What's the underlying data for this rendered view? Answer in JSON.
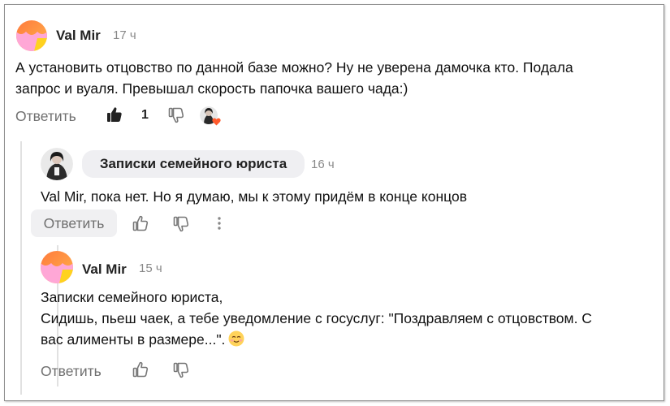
{
  "comments": [
    {
      "author": "Val Mir",
      "time": "17 ч",
      "text_line1": "А установить отцовство по данной базе можно? Ну не уверена дамочка кто. Подала",
      "text_line2": "запрос и вуаля. Превышал скорость папочка вашего чада:)",
      "reply_label": "Ответить",
      "like_count": "1"
    },
    {
      "author": "Записки семейного юриста",
      "time": "16 ч",
      "text_line1": "Val Mir, пока нет. Но я думаю, мы к этому придём в конце концов",
      "reply_label": "Ответить"
    },
    {
      "author": "Val Mir",
      "time": "15 ч",
      "text_line1": "Записки семейного юриста,",
      "text_line2": "Сидишь, пьеш чаек, а тебе уведомление с госуслуг: \"Поздравляем с отцовством. С",
      "text_line3": "вас алименты в размере...\".",
      "reply_label": "Ответить"
    }
  ],
  "icons": {
    "like": "thumbs-up-icon",
    "dislike": "thumbs-down-icon",
    "more": "more-vertical-icon",
    "emoji": "smiling-face-emoji",
    "liker_avatar": "liker-avatar-with-heart"
  },
  "colors": {
    "muted_text": "#6f6f6f",
    "time_text": "#888888",
    "chip_bg": "#efeff2",
    "heart": "#ff5a2c"
  }
}
